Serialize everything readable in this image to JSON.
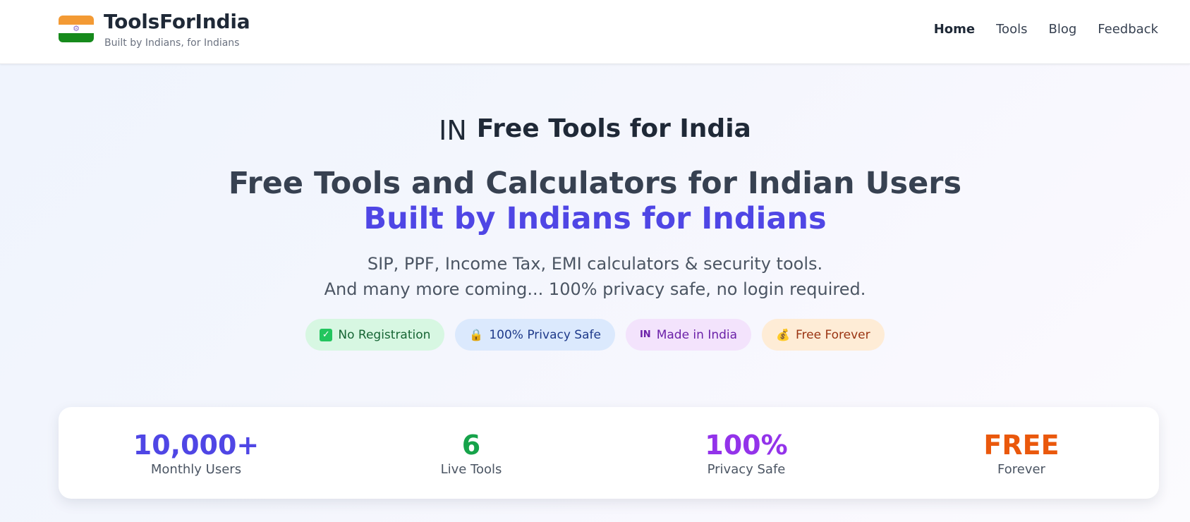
{
  "header": {
    "brand_title": "ToolsForIndia",
    "brand_tagline": "Built by Indians, for Indians",
    "logo_icon": "india-flag-icon",
    "nav": [
      {
        "label": "Home",
        "active": true
      },
      {
        "label": "Tools",
        "active": false
      },
      {
        "label": "Blog",
        "active": false
      },
      {
        "label": "Feedback",
        "active": false
      }
    ]
  },
  "hero": {
    "kicker_flag": "IN",
    "kicker": "Free Tools for India",
    "title": "Free Tools and Calculators for Indian Users",
    "subtitle": "Built by Indians for Indians",
    "description_line1": "SIP, PPF, Income Tax, EMI calculators & security tools.",
    "description_line2": "And many more coming... 100% privacy safe, no login required.",
    "badges": [
      {
        "icon": "check-box-icon",
        "glyph": "✓",
        "label": "No Registration"
      },
      {
        "icon": "lock-icon",
        "glyph": "🔒",
        "label": "100% Privacy Safe"
      },
      {
        "icon": "india-flag-icon",
        "glyph": "IN",
        "label": "Made in India"
      },
      {
        "icon": "money-bag-icon",
        "glyph": "💰",
        "label": "Free Forever"
      }
    ]
  },
  "stats": [
    {
      "value": "10,000+",
      "label": "Monthly Users",
      "color": "#4f46e5"
    },
    {
      "value": "6",
      "label": "Live Tools",
      "color": "#16a34a"
    },
    {
      "value": "100%",
      "label": "Privacy Safe",
      "color": "#9333ea"
    },
    {
      "value": "FREE",
      "label": "Forever",
      "color": "#ea580c"
    }
  ],
  "colors": {
    "accent": "#4f46e5",
    "saffron": "#f39a34",
    "green": "#168a1c"
  }
}
